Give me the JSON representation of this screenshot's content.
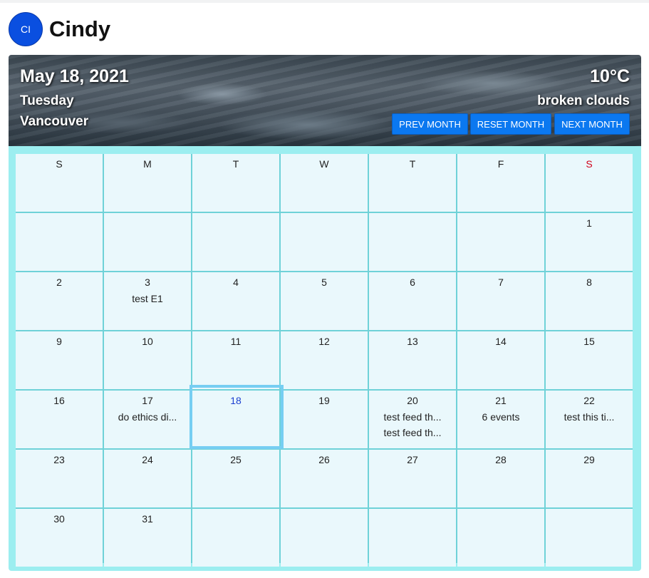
{
  "user": {
    "initials": "CI",
    "name": "Cindy"
  },
  "header": {
    "date": "May 18, 2021",
    "weekday": "Tuesday",
    "city": "Vancouver",
    "temperature": "10°C",
    "condition": "broken clouds",
    "buttons": {
      "prev": "PREV MONTH",
      "reset": "RESET MONTH",
      "next": "NEXT MONTH"
    }
  },
  "calendar": {
    "weekdays": [
      "S",
      "M",
      "T",
      "W",
      "T",
      "F",
      "S"
    ],
    "today": "18",
    "weeks": [
      [
        {
          "d": ""
        },
        {
          "d": ""
        },
        {
          "d": ""
        },
        {
          "d": ""
        },
        {
          "d": ""
        },
        {
          "d": ""
        },
        {
          "d": "1"
        }
      ],
      [
        {
          "d": "2"
        },
        {
          "d": "3",
          "events": [
            "test E1"
          ]
        },
        {
          "d": "4"
        },
        {
          "d": "5"
        },
        {
          "d": "6"
        },
        {
          "d": "7"
        },
        {
          "d": "8"
        }
      ],
      [
        {
          "d": "9"
        },
        {
          "d": "10"
        },
        {
          "d": "11"
        },
        {
          "d": "12"
        },
        {
          "d": "13"
        },
        {
          "d": "14"
        },
        {
          "d": "15"
        }
      ],
      [
        {
          "d": "16"
        },
        {
          "d": "17",
          "events": [
            "do ethics di..."
          ]
        },
        {
          "d": "18"
        },
        {
          "d": "19"
        },
        {
          "d": "20",
          "events": [
            "test feed th...",
            "test feed th..."
          ]
        },
        {
          "d": "21",
          "events": [
            "6 events"
          ]
        },
        {
          "d": "22",
          "events": [
            "test this ti..."
          ]
        }
      ],
      [
        {
          "d": "23"
        },
        {
          "d": "24"
        },
        {
          "d": "25"
        },
        {
          "d": "26"
        },
        {
          "d": "27"
        },
        {
          "d": "28"
        },
        {
          "d": "29"
        }
      ],
      [
        {
          "d": "30"
        },
        {
          "d": "31"
        },
        {
          "d": ""
        },
        {
          "d": ""
        },
        {
          "d": ""
        },
        {
          "d": ""
        },
        {
          "d": ""
        }
      ]
    ]
  },
  "colors": {
    "accent_button": "#0b78f0",
    "avatar": "#0a4fe0",
    "calendar_bg": "#9ceef0",
    "cell_bg": "#eaf8fc",
    "saturday_header": "#d0021b",
    "today_number": "#1b3fd0",
    "today_outline": "#76cef2"
  }
}
